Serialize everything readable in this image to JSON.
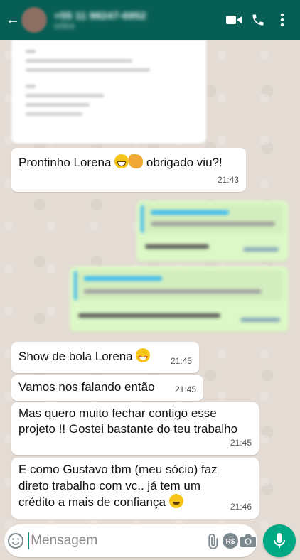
{
  "header": {
    "contact_name": "+55 11 98247-6952",
    "contact_status": "online"
  },
  "messages": [
    {
      "text": "Prontinho Lorena",
      "emoji": [
        "beaming-face",
        "handshake"
      ],
      "text2": "obrigado viu?!",
      "time": "21:43"
    },
    {
      "text": "Show de bola Lorena",
      "emoji": [
        "star-struck"
      ],
      "time": "21:45"
    },
    {
      "text": "Vamos nos falando então",
      "time": "21:45"
    },
    {
      "text": "Mas quero muito fechar contigo esse projeto !! Gostei bastante do teu trabalho",
      "time": "21:45"
    },
    {
      "text": "E como Gustavo tbm (meu sócio) faz direto trabalho com vc.. já tem um crédito a mais de confiança",
      "emoji": [
        "grinning-face"
      ],
      "time": "21:46"
    }
  ],
  "input": {
    "placeholder": "Mensagem"
  },
  "colors": {
    "header": "#075e54",
    "outgoing_bubble": "#dcf8c6",
    "incoming_bubble": "#ffffff",
    "mic_button": "#00a884",
    "quote_bar": "#34b7f1"
  }
}
